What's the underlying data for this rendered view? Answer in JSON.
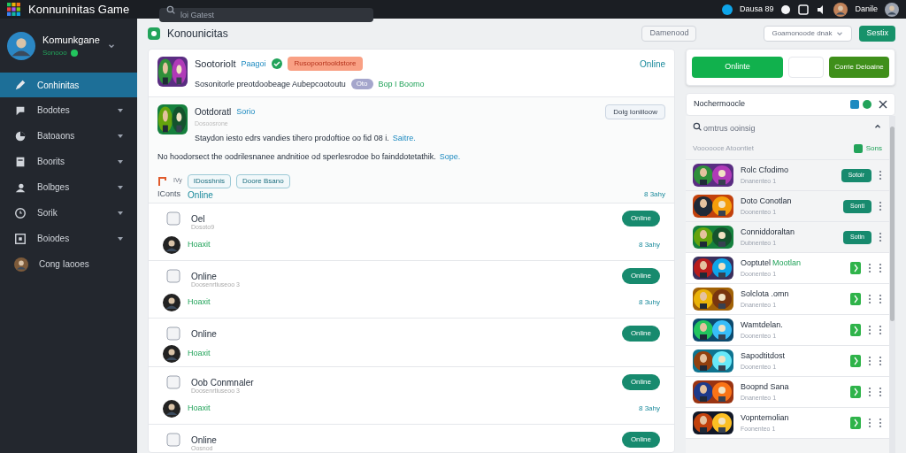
{
  "topbar": {
    "app_title": "Konnuninitas Game",
    "search": {
      "placeholder": "loi Gatest"
    },
    "counter": "Dausa 89",
    "user_name": "Danile"
  },
  "sidebar": {
    "profile": {
      "name": "Komunkgane",
      "status": "Sonooo"
    },
    "items": [
      {
        "label": "Conhinitas",
        "selected": true,
        "kind": "pen",
        "expandable": false
      },
      {
        "label": "Bodotes",
        "selected": false,
        "kind": "chat",
        "expandable": true
      },
      {
        "label": "Batoaons",
        "selected": false,
        "kind": "pie",
        "expandable": true
      },
      {
        "label": "Boorits",
        "selected": false,
        "kind": "doc",
        "expandable": true
      },
      {
        "label": "Bolbges",
        "selected": false,
        "kind": "users",
        "expandable": true
      },
      {
        "label": "Sorik",
        "selected": false,
        "kind": "clock",
        "expandable": true
      },
      {
        "label": "Boiodes",
        "selected": false,
        "kind": "grid",
        "expandable": true
      },
      {
        "label": "Cong Iaooes",
        "selected": false,
        "kind": "avatar",
        "expandable": false
      }
    ]
  },
  "main": {
    "title": "Konounicitas",
    "toolbar": {
      "plain_button": "Damenood",
      "dropdown": "Goamonoode dnak",
      "primary_button": "Sestix"
    },
    "featured": [
      {
        "author": "Sootoriolt",
        "link": "Paagoi",
        "verified": true,
        "tag": "Rusopoortooldstore",
        "body": "Sosonitorle preotdoobeage Aubepcootoutu",
        "chip": "Oto",
        "green_link": "Bop I Boomo",
        "status": "Online"
      },
      {
        "author": "Ootdoratl",
        "link": "Sorio",
        "subtitle": "Dosoosrone",
        "lines": [
          {
            "text": "Staydon iesto edrs vandies tihero prodoftioe oo fid 08 i.",
            "link": "Saitre."
          },
          {
            "text": "No hoodorsect the oodrilesnanee andnitioe od sperlesrodoe bo fainddotetathik.",
            "link": "Sope."
          }
        ],
        "menu_button": "Dolg Ioniiloow",
        "small_label": "IVy",
        "chips": [
          "IDosshnis",
          "Doore Bsano"
        ],
        "footer_label": "IConts",
        "footer_status": "Online",
        "time": "8 3ahy"
      }
    ],
    "items": [
      {
        "title": "Oel",
        "subtitle": "Dosoto9",
        "tag": "Hoaxit",
        "button": "Online",
        "time": "8 3ahy"
      },
      {
        "title": "Online",
        "subtitle": "Doosenrtiuseoo 3",
        "tag": "Hoaxit",
        "button": "Online",
        "time": "8 3uhy"
      },
      {
        "title": "Online",
        "tag": "Hoaxit",
        "button": "Online"
      },
      {
        "title": "Oob Conmnaler",
        "subtitle": "Doosenrtiuseoo 3",
        "tag": "Hoaxit",
        "button": "Online",
        "time": "8 3ahy"
      },
      {
        "title": "Online",
        "subtitle": "Oosnod",
        "button": "Online"
      }
    ]
  },
  "right": {
    "actions": {
      "primary": "Onlinte",
      "secondary": "Corrie Deloaine"
    },
    "notice": {
      "title": "Nochermoocle"
    },
    "search": {
      "placeholder": "omtrus ooinsig"
    },
    "section": {
      "title": "Voooooce Atoontiet",
      "action": "Sons"
    },
    "games": [
      {
        "name": "Rolc Cfodimo",
        "subtitle": "Dnanenteo 1",
        "kind": "button",
        "button": "Sotoir",
        "highlighted": true
      },
      {
        "name": "Doto Conotlan",
        "subtitle": "Doonenteo 1",
        "kind": "button",
        "button": "Sonti",
        "highlighted": true
      },
      {
        "name": "Conniddoraltan",
        "subtitle": "Dubnenteo 1",
        "kind": "button",
        "button": "Sotin",
        "highlighted": true
      },
      {
        "name": "Ooptutel",
        "name_accent": "Mootlan",
        "subtitle": "Doonenteo 1",
        "kind": "icon",
        "highlighted": false
      },
      {
        "name": "Solclota .omn",
        "subtitle": "Dnanenteo 1",
        "kind": "icon",
        "highlighted": false
      },
      {
        "name": "Wamtdelan.",
        "subtitle": "Doonenteo 1",
        "kind": "icon",
        "highlighted": false
      },
      {
        "name": "Sapodtitdost",
        "subtitle": "Doonenteo 1",
        "kind": "icon",
        "highlighted": false
      },
      {
        "name": "Boopnd Sana",
        "subtitle": "Dnanenteo 1",
        "kind": "icon",
        "highlighted": false
      },
      {
        "name": "Vopntemolian",
        "subtitle": "Foonenteo 1",
        "kind": "icon",
        "highlighted": false
      }
    ]
  }
}
